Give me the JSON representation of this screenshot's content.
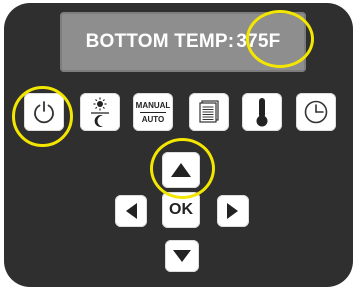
{
  "display": {
    "label": "BOTTOM TEMP:",
    "value": "375F"
  },
  "buttons": {
    "power": {
      "icon": "power-icon"
    },
    "day_night": {
      "icon": "sun-moon-icon"
    },
    "mode": {
      "manual_label": "MANUAL",
      "auto_label": "AUTO"
    },
    "menu": {
      "icon": "stacked-pages-icon"
    },
    "temperature": {
      "icon": "thermometer-icon"
    },
    "timer": {
      "icon": "clock-icon"
    },
    "up": {
      "icon": "up-arrow-icon"
    },
    "left": {
      "icon": "left-arrow-icon"
    },
    "ok": {
      "label": "OK"
    },
    "right": {
      "icon": "right-arrow-icon"
    },
    "down": {
      "icon": "down-arrow-icon"
    }
  },
  "highlight_color": "#f3e600",
  "panel_color": "#2f2f2f"
}
